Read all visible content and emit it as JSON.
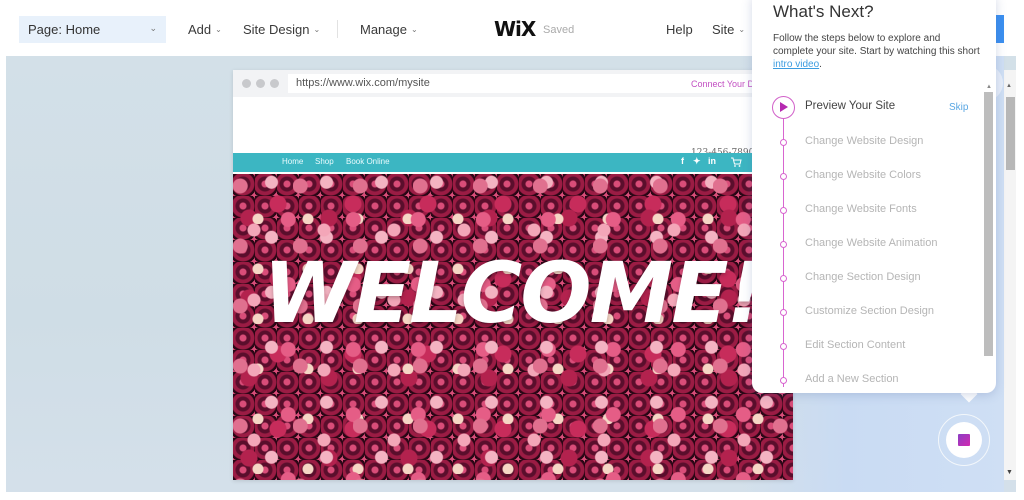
{
  "topbar": {
    "page_select": "Page: Home",
    "menus": [
      "Add",
      "Site Design",
      "Manage"
    ],
    "logo": "WiX",
    "status": "Saved",
    "help": "Help",
    "site": "Site"
  },
  "mock_site": {
    "url": "https://www.wix.com/mysite",
    "connect_domain": "Connect Your D",
    "phone": "123-456-7890",
    "nav": [
      "Home",
      "Shop",
      "Book Online"
    ],
    "social": [
      "f",
      "t",
      "in"
    ],
    "hero_text": "WELCOME!"
  },
  "whats_next": {
    "title": "What's Next?",
    "description_prefix": "Follow the steps below to explore and complete your site. Start by watching this short ",
    "link": "intro video",
    "description_suffix": ".",
    "skip": "Skip",
    "steps": [
      {
        "label": "Preview Your Site",
        "active": true
      },
      {
        "label": "Change Website Design",
        "active": false
      },
      {
        "label": "Change Website Colors",
        "active": false
      },
      {
        "label": "Change Website Fonts",
        "active": false
      },
      {
        "label": "Change Website Animation",
        "active": false
      },
      {
        "label": "Change Section Design",
        "active": false
      },
      {
        "label": "Customize Section Design",
        "active": false
      },
      {
        "label": "Edit Section Content",
        "active": false
      },
      {
        "label": "Add a New Section",
        "active": false
      }
    ]
  },
  "colors": {
    "accent_pink": "#d160c9",
    "nav_teal": "#3cb6c2",
    "link_blue": "#3b9ce0",
    "primary_blue": "#3b8ff0"
  }
}
